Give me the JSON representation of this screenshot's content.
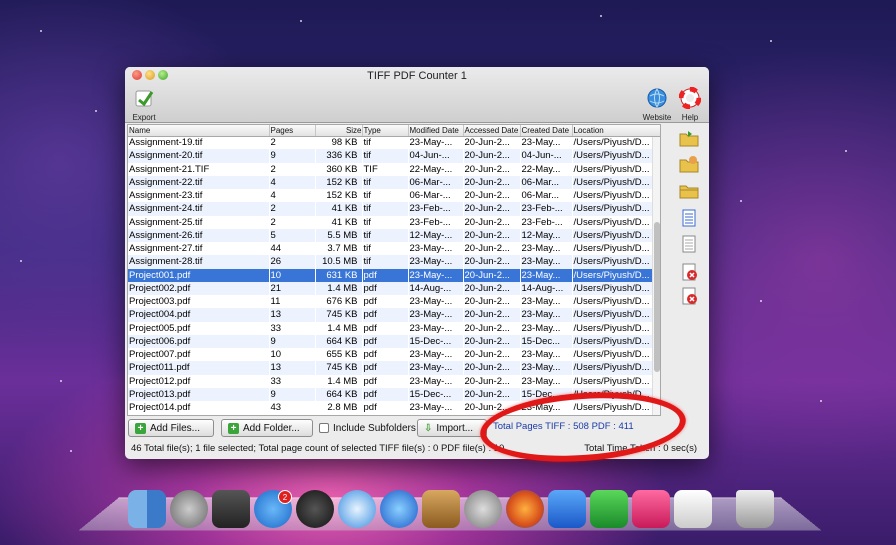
{
  "window": {
    "title": "TIFF PDF Counter 1",
    "toolbar": {
      "export_label": "Export",
      "website_label": "Website",
      "help_label": "Help"
    }
  },
  "table": {
    "columns": [
      "Name",
      "Pages",
      "Size",
      "Type",
      "Modified Date",
      "Accessed Date",
      "Created Date",
      "Location"
    ],
    "rows": [
      [
        "Assignment-19.tif",
        "2",
        "98 KB",
        "tif",
        "23-May-...",
        "20-Jun-2...",
        "23-May...",
        "/Users/Piyush/D..."
      ],
      [
        "Assignment-20.tif",
        "9",
        "336 KB",
        "tif",
        "04-Jun-...",
        "20-Jun-2...",
        "04-Jun-...",
        "/Users/Piyush/D..."
      ],
      [
        "Assignment-21.TIF",
        "2",
        "360 KB",
        "TIF",
        "22-May-...",
        "20-Jun-2...",
        "22-May...",
        "/Users/Piyush/D..."
      ],
      [
        "Assignment-22.tif",
        "4",
        "152 KB",
        "tif",
        "06-Mar-...",
        "20-Jun-2...",
        "06-Mar...",
        "/Users/Piyush/D..."
      ],
      [
        "Assignment-23.tif",
        "4",
        "152 KB",
        "tif",
        "06-Mar-...",
        "20-Jun-2...",
        "06-Mar...",
        "/Users/Piyush/D..."
      ],
      [
        "Assignment-24.tif",
        "2",
        "41 KB",
        "tif",
        "23-Feb-...",
        "20-Jun-2...",
        "23-Feb-...",
        "/Users/Piyush/D..."
      ],
      [
        "Assignment-25.tif",
        "2",
        "41 KB",
        "tif",
        "23-Feb-...",
        "20-Jun-2...",
        "23-Feb-...",
        "/Users/Piyush/D..."
      ],
      [
        "Assignment-26.tif",
        "5",
        "5.5 MB",
        "tif",
        "12-May-...",
        "20-Jun-2...",
        "12-May...",
        "/Users/Piyush/D..."
      ],
      [
        "Assignment-27.tif",
        "44",
        "3.7 MB",
        "tif",
        "23-May-...",
        "20-Jun-2...",
        "23-May...",
        "/Users/Piyush/D..."
      ],
      [
        "Assignment-28.tif",
        "26",
        "10.5 MB",
        "tif",
        "23-May-...",
        "20-Jun-2...",
        "23-May...",
        "/Users/Piyush/D..."
      ],
      [
        "Project001.pdf",
        "10",
        "631 KB",
        "pdf",
        "23-May-...",
        "20-Jun-2...",
        "23-May...",
        "/Users/Piyush/D..."
      ],
      [
        "Project002.pdf",
        "21",
        "1.4 MB",
        "pdf",
        "14-Aug-...",
        "20-Jun-2...",
        "14-Aug-...",
        "/Users/Piyush/D..."
      ],
      [
        "Project003.pdf",
        "11",
        "676 KB",
        "pdf",
        "23-May-...",
        "20-Jun-2...",
        "23-May...",
        "/Users/Piyush/D..."
      ],
      [
        "Project004.pdf",
        "13",
        "745 KB",
        "pdf",
        "23-May-...",
        "20-Jun-2...",
        "23-May...",
        "/Users/Piyush/D..."
      ],
      [
        "Project005.pdf",
        "33",
        "1.4 MB",
        "pdf",
        "23-May-...",
        "20-Jun-2...",
        "23-May...",
        "/Users/Piyush/D..."
      ],
      [
        "Project006.pdf",
        "9",
        "664 KB",
        "pdf",
        "15-Dec-...",
        "20-Jun-2...",
        "15-Dec...",
        "/Users/Piyush/D..."
      ],
      [
        "Project007.pdf",
        "10",
        "655 KB",
        "pdf",
        "23-May-...",
        "20-Jun-2...",
        "23-May...",
        "/Users/Piyush/D..."
      ],
      [
        "Project011.pdf",
        "13",
        "745 KB",
        "pdf",
        "23-May-...",
        "20-Jun-2...",
        "23-May...",
        "/Users/Piyush/D..."
      ],
      [
        "Project012.pdf",
        "33",
        "1.4 MB",
        "pdf",
        "23-May-...",
        "20-Jun-2...",
        "23-May...",
        "/Users/Piyush/D..."
      ],
      [
        "Project013.pdf",
        "9",
        "664 KB",
        "pdf",
        "15-Dec-...",
        "20-Jun-2...",
        "15-Dec...",
        "/Users/Piyush/D..."
      ],
      [
        "Project014.pdf",
        "43",
        "2.8 MB",
        "pdf",
        "23-May-...",
        "20-Jun-2...",
        "23-May...",
        "/Users/Piyush/D..."
      ]
    ],
    "selected_row": 10
  },
  "bottom": {
    "add_files_label": "Add Files...",
    "add_folder_label": "Add Folder...",
    "include_subfolders_label": "Include Subfolders",
    "import_label": "Import...",
    "total_pages_text": "Total Pages TIFF : 508 PDF : 411"
  },
  "status": {
    "summary": "46 Total file(s); 1 file selected; Total page count of selected TIFF file(s) : 0 PDF file(s) : 10",
    "time_taken": "Total Time Taken : 0 sec(s)"
  },
  "dock": {
    "appstore_badge": "2"
  },
  "colors": {
    "selection": "#3875d7",
    "annotation_red": "#e01818",
    "total_text": "#1a3aa8"
  }
}
